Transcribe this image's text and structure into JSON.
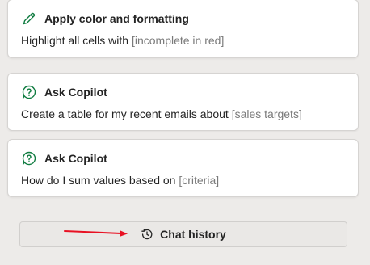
{
  "prompts": [
    {
      "icon": "pencil-icon",
      "title": "Apply color and formatting",
      "text": "Highlight all cells with ",
      "placeholder": "[incomplete in red]"
    },
    {
      "icon": "chat-question-icon",
      "title": "Ask Copilot",
      "text": "Create a table for my recent emails about ",
      "placeholder": "[sales targets]"
    },
    {
      "icon": "chat-question-icon",
      "title": "Ask Copilot",
      "text": "How do I sum values based on ",
      "placeholder": "[criteria]"
    }
  ],
  "chat_history": {
    "icon": "history-icon",
    "label": "Chat history"
  },
  "annotation": {
    "arrow_color": "#e81123"
  },
  "colors": {
    "accent_green": "#107c41",
    "background": "#edebe9",
    "card": "#ffffff"
  }
}
